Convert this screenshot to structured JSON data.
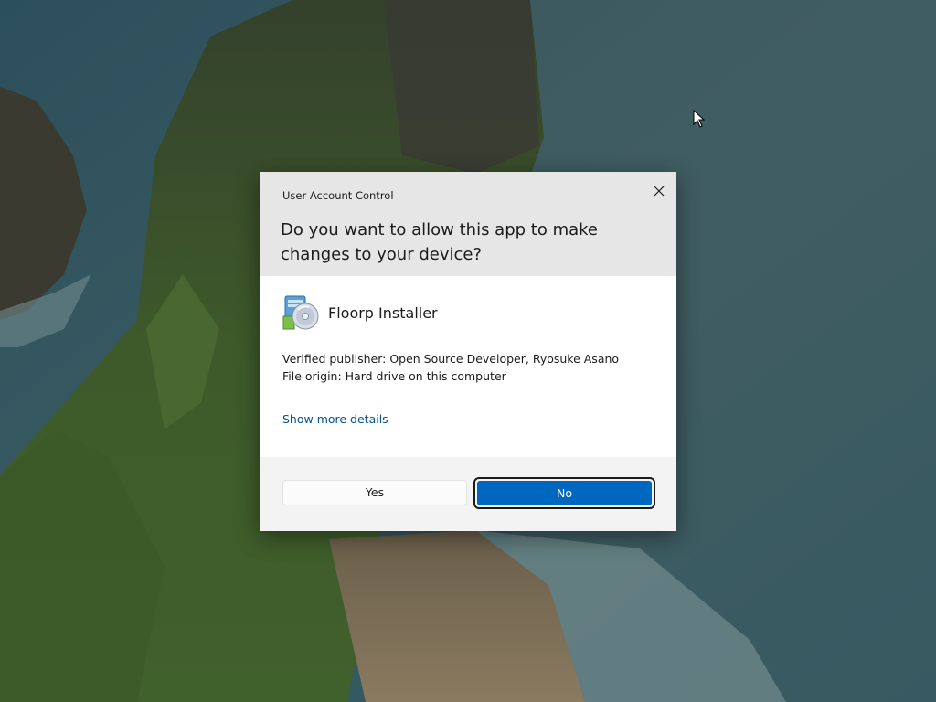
{
  "dialog": {
    "title": "User Account Control",
    "question": "Do you want to allow this app to make changes to your device?",
    "app_name": "Floorp Installer",
    "app_icon": "installer-disc-icon",
    "publisher": "Verified publisher: Open Source Developer, Ryosuke Asano",
    "origin": "File origin: Hard drive on this computer",
    "more_details": "Show more details",
    "close_icon": "close-icon"
  },
  "buttons": {
    "yes_label": "Yes",
    "no_label": "No"
  },
  "colors": {
    "accent": "#0067c0",
    "header_bg": "#e6e6e6",
    "footer_bg": "#f3f3f3",
    "link": "#00538e"
  }
}
